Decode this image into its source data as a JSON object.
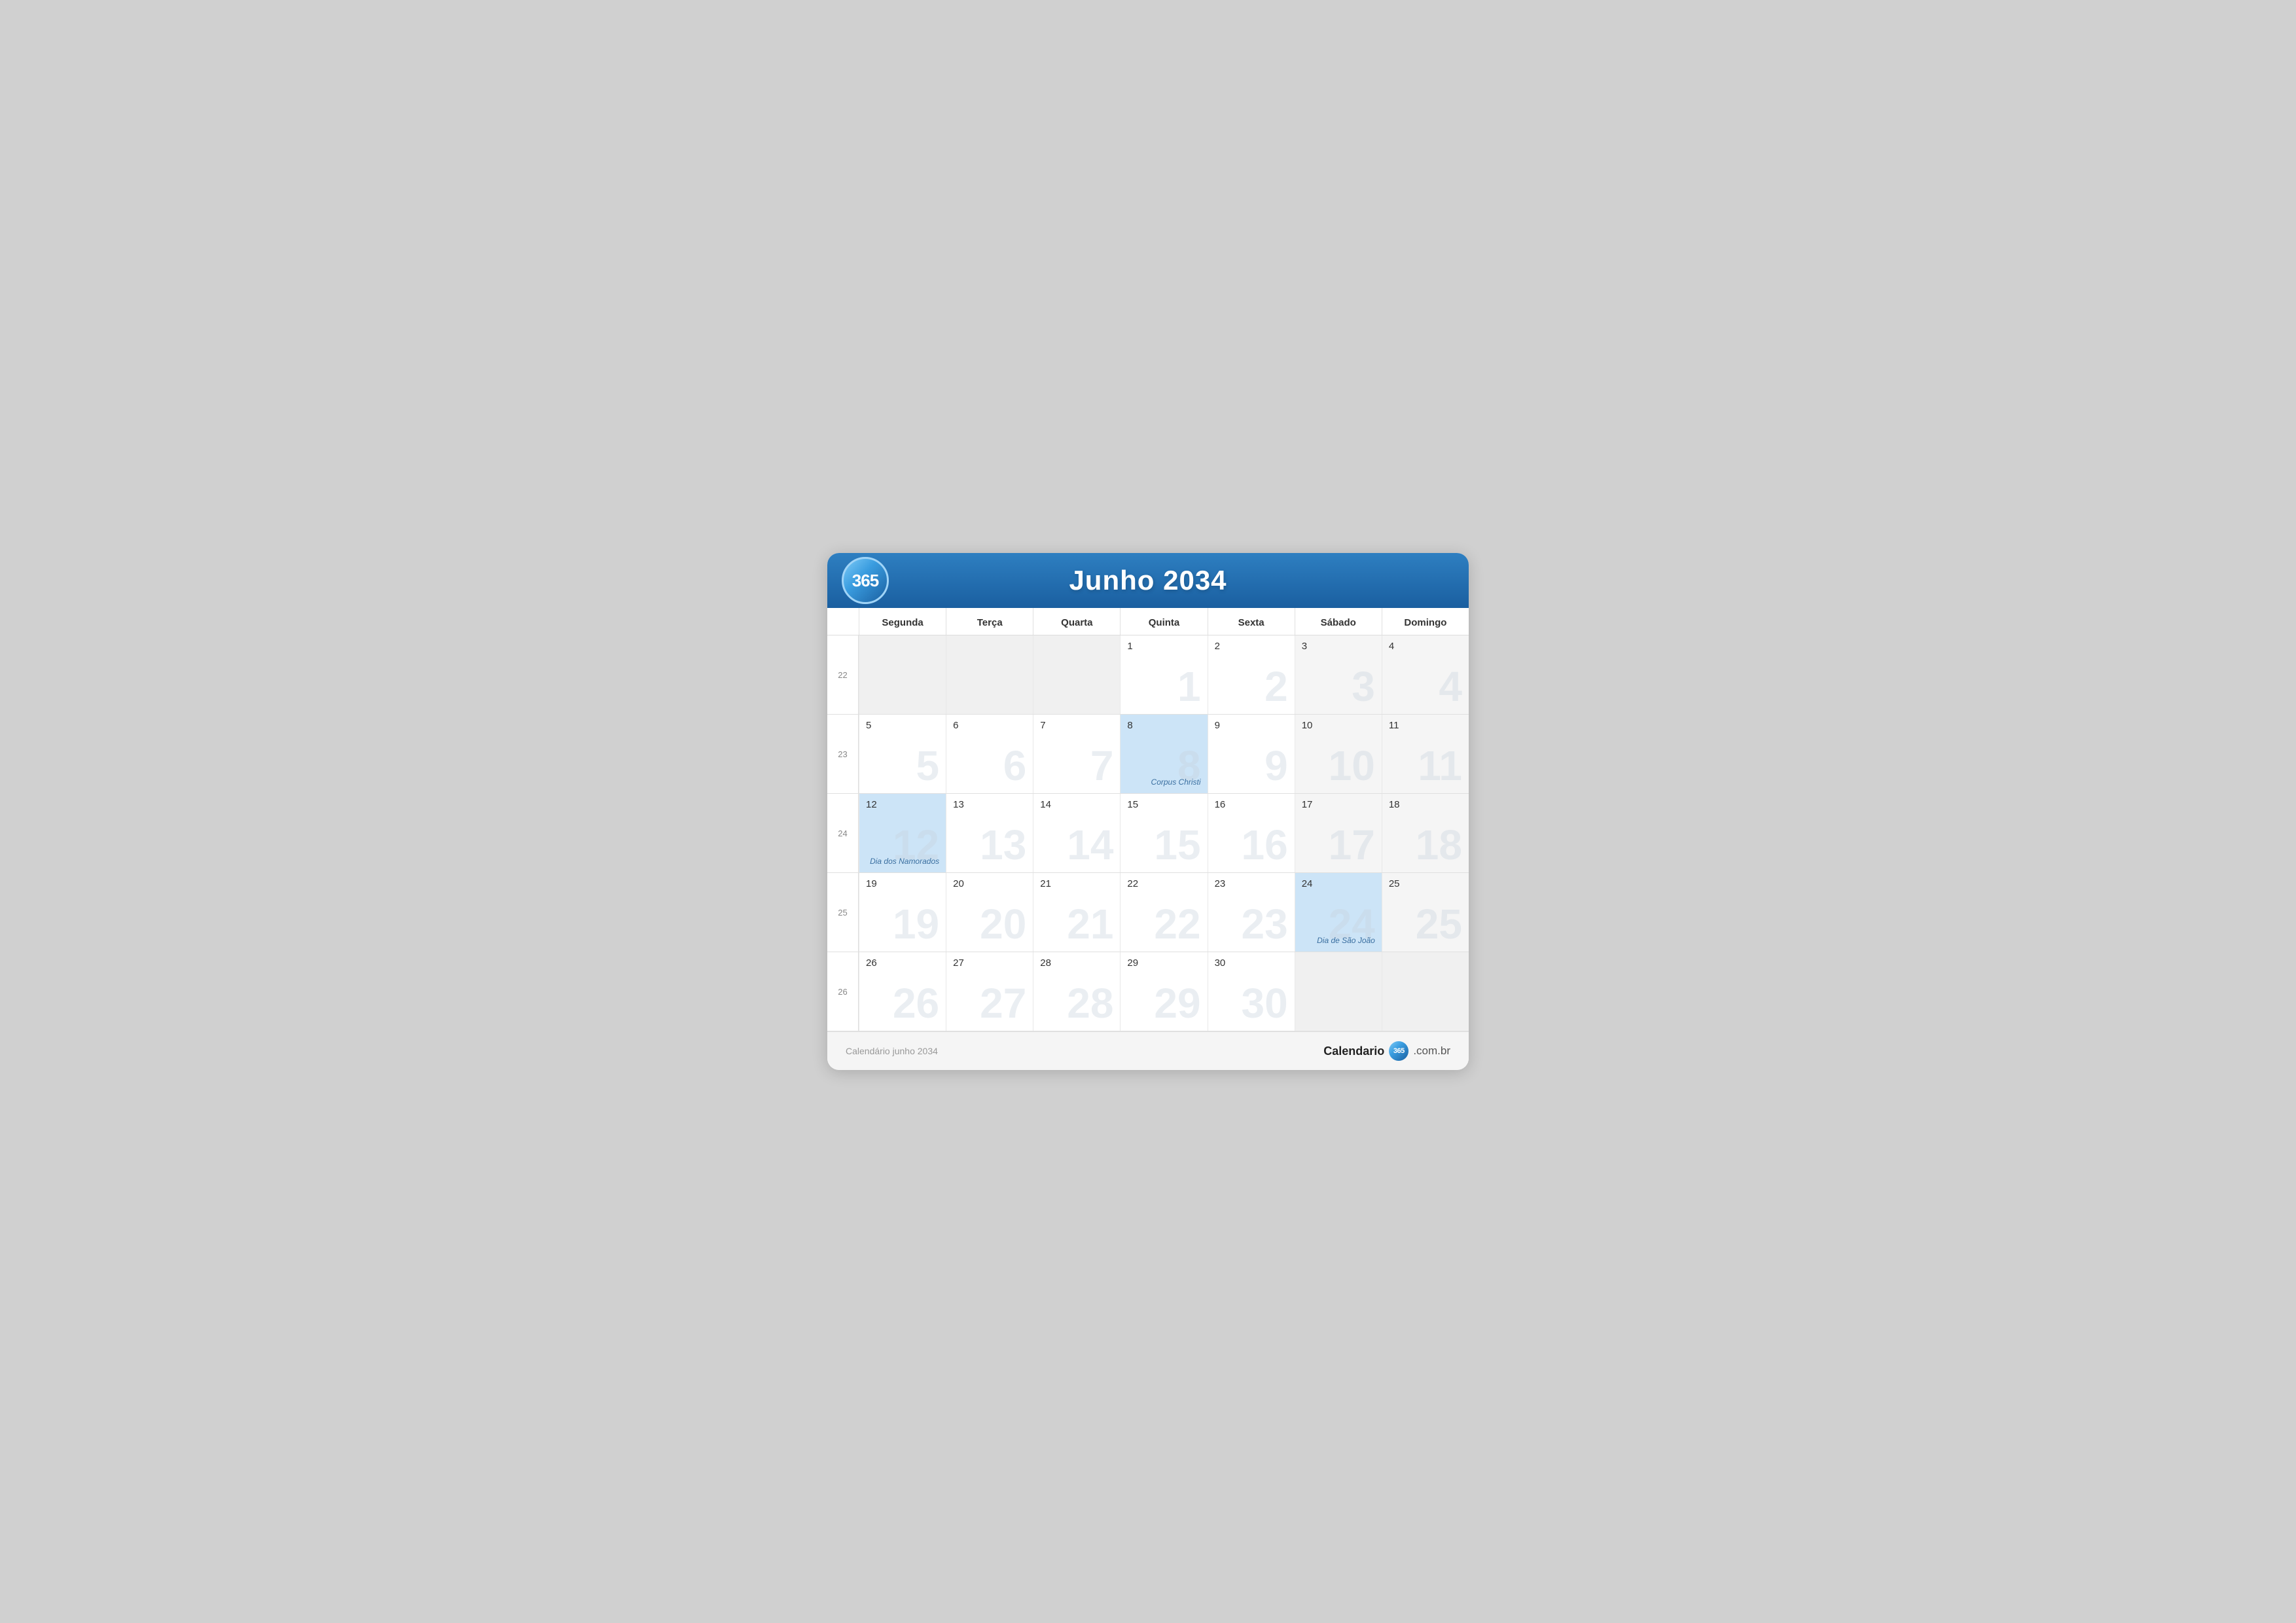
{
  "header": {
    "logo": "365",
    "title": "Junho 2034"
  },
  "weekdays": [
    {
      "label": "Segunda"
    },
    {
      "label": "Terça"
    },
    {
      "label": "Quarta"
    },
    {
      "label": "Quinta"
    },
    {
      "label": "Sexta"
    },
    {
      "label": "Sábado"
    },
    {
      "label": "Domingo"
    }
  ],
  "weeks": [
    {
      "week_number": "22",
      "days": [
        {
          "number": "",
          "empty": true,
          "watermark": ""
        },
        {
          "number": "",
          "empty": true,
          "watermark": ""
        },
        {
          "number": "",
          "empty": true,
          "watermark": ""
        },
        {
          "number": "1",
          "watermark": "1"
        },
        {
          "number": "2",
          "watermark": "2"
        },
        {
          "number": "3",
          "weekend": true,
          "watermark": "3"
        },
        {
          "number": "4",
          "weekend": true,
          "watermark": "4"
        }
      ]
    },
    {
      "week_number": "23",
      "days": [
        {
          "number": "5",
          "watermark": "5"
        },
        {
          "number": "6",
          "watermark": "6"
        },
        {
          "number": "7",
          "watermark": "7"
        },
        {
          "number": "8",
          "highlight": true,
          "watermark": "8",
          "event": "Corpus Christi"
        },
        {
          "number": "9",
          "watermark": "9"
        },
        {
          "number": "10",
          "weekend": true,
          "watermark": "10"
        },
        {
          "number": "11",
          "weekend": true,
          "watermark": "11"
        }
      ]
    },
    {
      "week_number": "24",
      "days": [
        {
          "number": "12",
          "highlight": true,
          "watermark": "12",
          "event": "Dia dos Namorados"
        },
        {
          "number": "13",
          "watermark": "13"
        },
        {
          "number": "14",
          "watermark": "14"
        },
        {
          "number": "15",
          "watermark": "15"
        },
        {
          "number": "16",
          "watermark": "16"
        },
        {
          "number": "17",
          "weekend": true,
          "watermark": "17"
        },
        {
          "number": "18",
          "weekend": true,
          "watermark": "18"
        }
      ]
    },
    {
      "week_number": "25",
      "days": [
        {
          "number": "19",
          "watermark": "19"
        },
        {
          "number": "20",
          "watermark": "20"
        },
        {
          "number": "21",
          "watermark": "21"
        },
        {
          "number": "22",
          "watermark": "22"
        },
        {
          "number": "23",
          "watermark": "23"
        },
        {
          "number": "24",
          "highlight": true,
          "weekend": true,
          "watermark": "24",
          "event": "Dia de São João"
        },
        {
          "number": "25",
          "weekend": true,
          "watermark": "25"
        }
      ]
    },
    {
      "week_number": "26",
      "days": [
        {
          "number": "26",
          "watermark": "26"
        },
        {
          "number": "27",
          "watermark": "27"
        },
        {
          "number": "28",
          "watermark": "28"
        },
        {
          "number": "29",
          "watermark": "29"
        },
        {
          "number": "30",
          "watermark": "30"
        },
        {
          "number": "",
          "empty": true,
          "weekend": true,
          "watermark": ""
        },
        {
          "number": "",
          "empty": true,
          "weekend": true,
          "watermark": ""
        }
      ]
    }
  ],
  "footer": {
    "left_text": "Calendário junho 2034",
    "brand_text_pre": "Calendario",
    "brand_logo": "365",
    "brand_text_post": ".com.br"
  }
}
